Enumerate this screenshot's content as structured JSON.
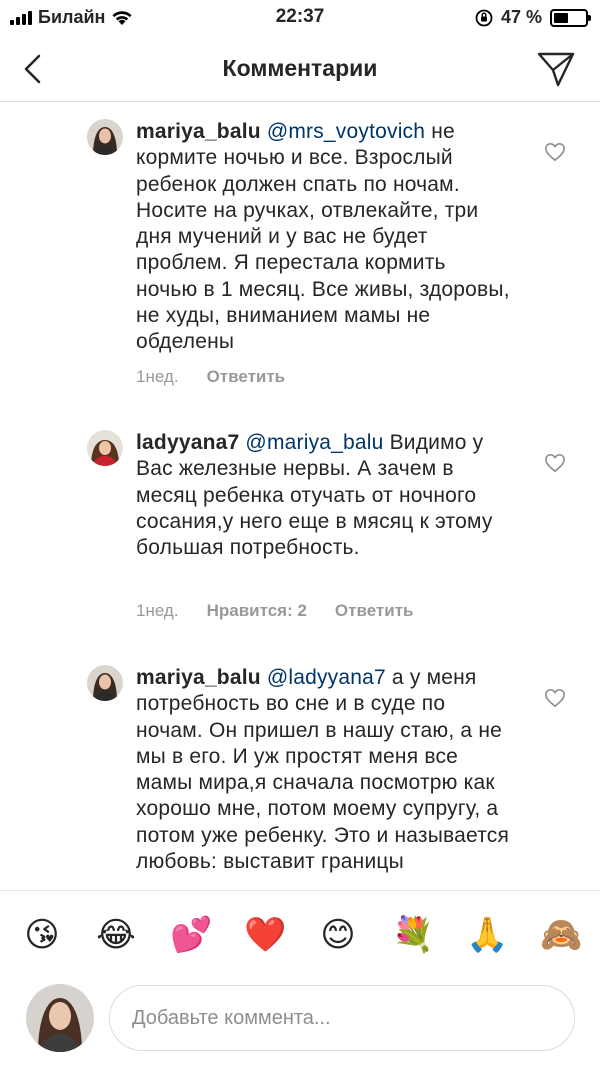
{
  "status_bar": {
    "carrier": "Билайн",
    "time": "22:37",
    "battery_percent": "47 %",
    "battery_level": 0.47
  },
  "header": {
    "title": "Комментарии",
    "back_icon": "chevron-left-icon",
    "send_icon": "paper-plane-icon"
  },
  "comments": [
    {
      "username": "mariya_balu",
      "mention": "@mrs_voytovich",
      "text": "не кормите ночью и все. Взрослый ребенок должен спать по ночам. Носите на ручках, отвлекайте, три дня мучений и у вас не будет проблем. Я перестала кормить ночью в 1 месяц. Все живы, здоровы, не худы, вниманием мамы не обделены",
      "time": "1нед.",
      "likes": "",
      "reply": "Ответить"
    },
    {
      "username": "ladyyana7",
      "mention": "@mariya_balu",
      "text": "Видимо у Вас железные нервы. А зачем в месяц ребенка отучать от ночного сосания,у него еще в мясяц к этому большая потребность.",
      "time": "1нед.",
      "likes": "Нравится: 2",
      "reply": "Ответить"
    },
    {
      "username": "mariya_balu",
      "mention": "@ladyyana7",
      "text": "а у меня потребность во сне и в суде по ночам. Он пришел в нашу стаю, а не мы в его. И уж простят меня все мамы мира,я сначала посмотрю как хорошо мне, потом моему супругу, а потом уже ребенку. Это и называется любовь: выставит границы",
      "time": "",
      "likes": "",
      "reply": ""
    }
  ],
  "emoji_bar": [
    "😘",
    "😂",
    "💕",
    "❤️",
    "😊",
    "💐",
    "🙏",
    "🙈"
  ],
  "composer": {
    "placeholder": "Добавьте коммента..."
  },
  "colors": {
    "mention": "#003569",
    "meta": "#999999",
    "text": "#262626",
    "divider": "#dbdbdb"
  }
}
